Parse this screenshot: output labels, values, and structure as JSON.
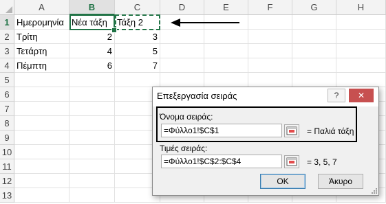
{
  "sheet": {
    "columns": [
      "A",
      "B",
      "C",
      "D",
      "E",
      "F",
      "G",
      "H"
    ],
    "rows": [
      "1",
      "2",
      "3",
      "4",
      "5",
      "6",
      "7",
      "8",
      "9",
      "10",
      "11",
      "12",
      "13"
    ],
    "cells": {
      "A1": "Ημερομηνία",
      "B1": "Νέα τάξη",
      "C1": "Τάξη 2",
      "A2": "Τρίτη",
      "B2": "2",
      "C2": "3",
      "A3": "Τετάρτη",
      "B3": "4",
      "C3": "5",
      "A4": "Πέμπτη",
      "B4": "6",
      "C4": "7"
    }
  },
  "dialog": {
    "title": "Επεξεργασία σειράς",
    "help_label": "?",
    "close_label": "✕",
    "series_name_label": "Όνομα σειράς:",
    "series_name_value": "=Φύλλο1!$C$1",
    "series_name_result": "= Παλιά τάξη",
    "series_values_label": "Τιμές σειράς:",
    "series_values_value": "=Φύλλο1!$C$2:$C$4",
    "series_values_result": "= 3, 5, 7",
    "ok_label": "OK",
    "cancel_label": "Άκυρο"
  },
  "colors": {
    "accent": "#217346",
    "highlight_border": "#000000"
  }
}
